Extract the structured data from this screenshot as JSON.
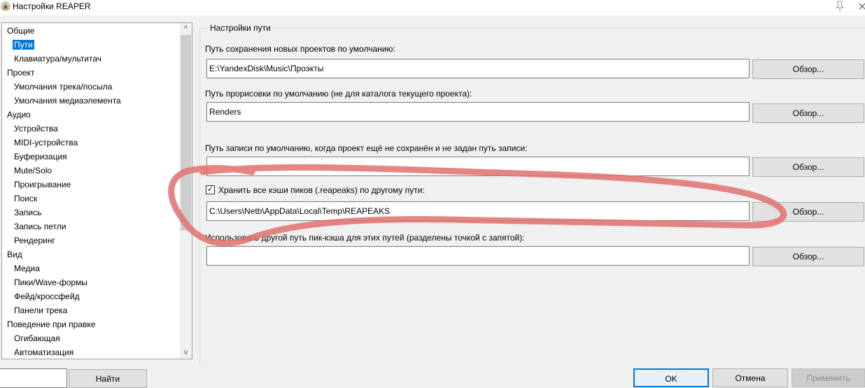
{
  "window": {
    "title": "Настройки REAPER"
  },
  "icons": {
    "app": "reaper-app-icon",
    "pin": "pin-icon",
    "close": "close-icon",
    "check": "checkmark-icon"
  },
  "tree": {
    "items": [
      {
        "label": "Общие"
      },
      {
        "label": "Пути"
      },
      {
        "label": "Клавиатура/мультитач"
      },
      {
        "label": "Проект"
      },
      {
        "label": "Умолчания трека/посыла"
      },
      {
        "label": "Умолчания медиаэлемента"
      },
      {
        "label": "Аудио"
      },
      {
        "label": "Устройства"
      },
      {
        "label": "MIDI-устройства"
      },
      {
        "label": "Буферизация"
      },
      {
        "label": "Mute/Solo"
      },
      {
        "label": "Проигрывание"
      },
      {
        "label": "Поиск"
      },
      {
        "label": "Запись"
      },
      {
        "label": "Запись петли"
      },
      {
        "label": "Рендеринг"
      },
      {
        "label": "Вид"
      },
      {
        "label": "Медиа"
      },
      {
        "label": "Пики/Wave-формы"
      },
      {
        "label": "Фейд/кроссфейд"
      },
      {
        "label": "Панели трека"
      },
      {
        "label": "Поведение при правке"
      },
      {
        "label": "Огибающая"
      },
      {
        "label": "Автоматизация"
      }
    ],
    "scroll_up": "^",
    "scroll_down": "v"
  },
  "section": {
    "title": "Настройки пути"
  },
  "fields": {
    "new_projects_label": "Путь сохранения новых проектов по умолчанию:",
    "new_projects_value": "E:\\YandexDisk\\Music\\Проэкты",
    "render_label": "Путь прорисовки по умолчанию (не для каталога текущего проекта):",
    "render_value": "Renders",
    "record_label": "Путь записи по умолчанию, когда проект ещё не сохранён и не задан путь записи:",
    "record_value": "",
    "peaks_checkbox_label": "Хранить все кэши пиков (.reapeaks) по другому пути:",
    "peaks_checked": true,
    "peaks_check_mark": "✓",
    "peaks_value": "C:\\Users\\Netb\\AppData\\Local\\Temp\\REAPEAKS",
    "alt_peaks_label": "Использовать другой путь пик-кэша для этих путей (разделены точкой с запятой):",
    "alt_peaks_value": ""
  },
  "buttons": {
    "browse": "Обзор...",
    "find": "Найти",
    "ok": "OK",
    "cancel": "Отмена",
    "apply": "Применить"
  },
  "colors": {
    "selection": "#0078d7",
    "annotation": "#e0706f"
  }
}
